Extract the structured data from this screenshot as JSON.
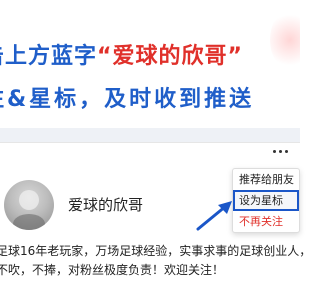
{
  "banner": {
    "line1_prefix": "击上方蓝字",
    "line1_highlight": "“爱球的欣哥”",
    "line2": "注&星标，及时收到推送"
  },
  "profile": {
    "name": "爱球的欣哥",
    "bio_line1": "足球16年老玩家，万场足球经验，实事求事的足球创业人，",
    "bio_line2": "不吹，不捧，对粉丝极度负责！欢迎关注！"
  },
  "menu": {
    "items": [
      "推荐给朋友",
      "设为星标",
      "不再关注"
    ]
  },
  "colors": {
    "banner_blue": "#1f5ec9",
    "banner_red": "#e0302a",
    "highlight_border": "#1a56c8"
  },
  "icons": [
    "more-icon",
    "arrow-pointer-icon",
    "avatar"
  ]
}
